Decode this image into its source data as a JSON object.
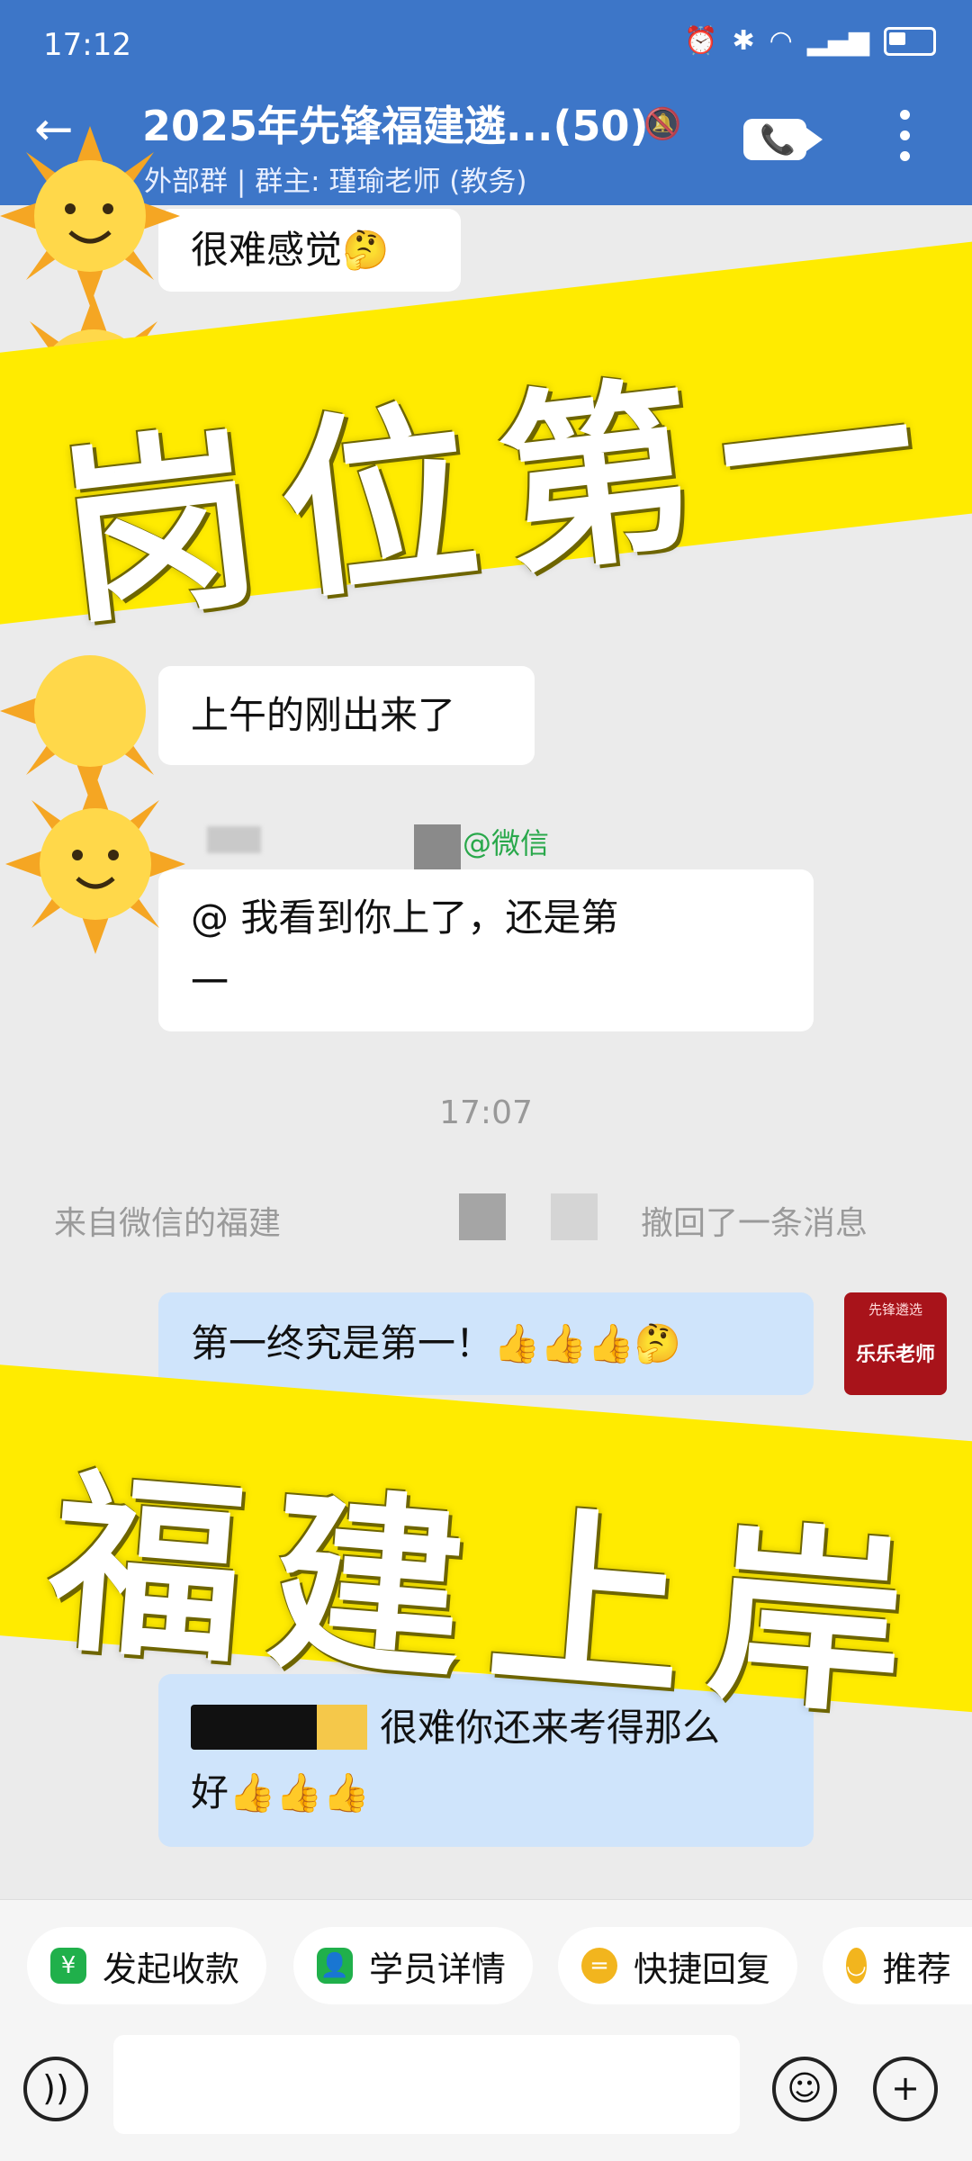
{
  "status": {
    "time": "17:12"
  },
  "header": {
    "title": "2025年先锋福建遴...(50)",
    "subtitle": "外部群 | 群主: 瑾瑜老师 (教务)"
  },
  "messages": {
    "m1": "很难感觉🤔",
    "m2": "上午的刚出来了",
    "m3_sender_suffix": "@微信",
    "m3_line1": "@     我看到你上了，还是第",
    "m3_line2": "一",
    "time_divider": "17:07",
    "sys_left": "来自微信的福建",
    "sys_right": "撤回了一条消息",
    "me1": "第一终究是第一！👍👍👍🤔",
    "me2_line1": "很难你还来考得那么",
    "me2_line2": "好👍👍👍"
  },
  "avatar_me": {
    "logo": "先锋遴选",
    "name": "乐乐老师"
  },
  "banners": {
    "top": "岗位第一",
    "bottom": "福建上岸"
  },
  "quick_actions": [
    {
      "label": "发起收款",
      "icon": "payment-icon",
      "color": "#20b04b"
    },
    {
      "label": "学员详情",
      "icon": "user-details-icon",
      "color": "#20b04b"
    },
    {
      "label": "快捷回复",
      "icon": "quick-reply-icon",
      "color": "#f2b51e"
    },
    {
      "label": "推荐",
      "icon": "recommend-icon",
      "color": "#f2b51e"
    }
  ],
  "colors": {
    "header": "#3d76c8",
    "banner": "#ffeb00",
    "my_bubble": "#cfe4fb"
  }
}
